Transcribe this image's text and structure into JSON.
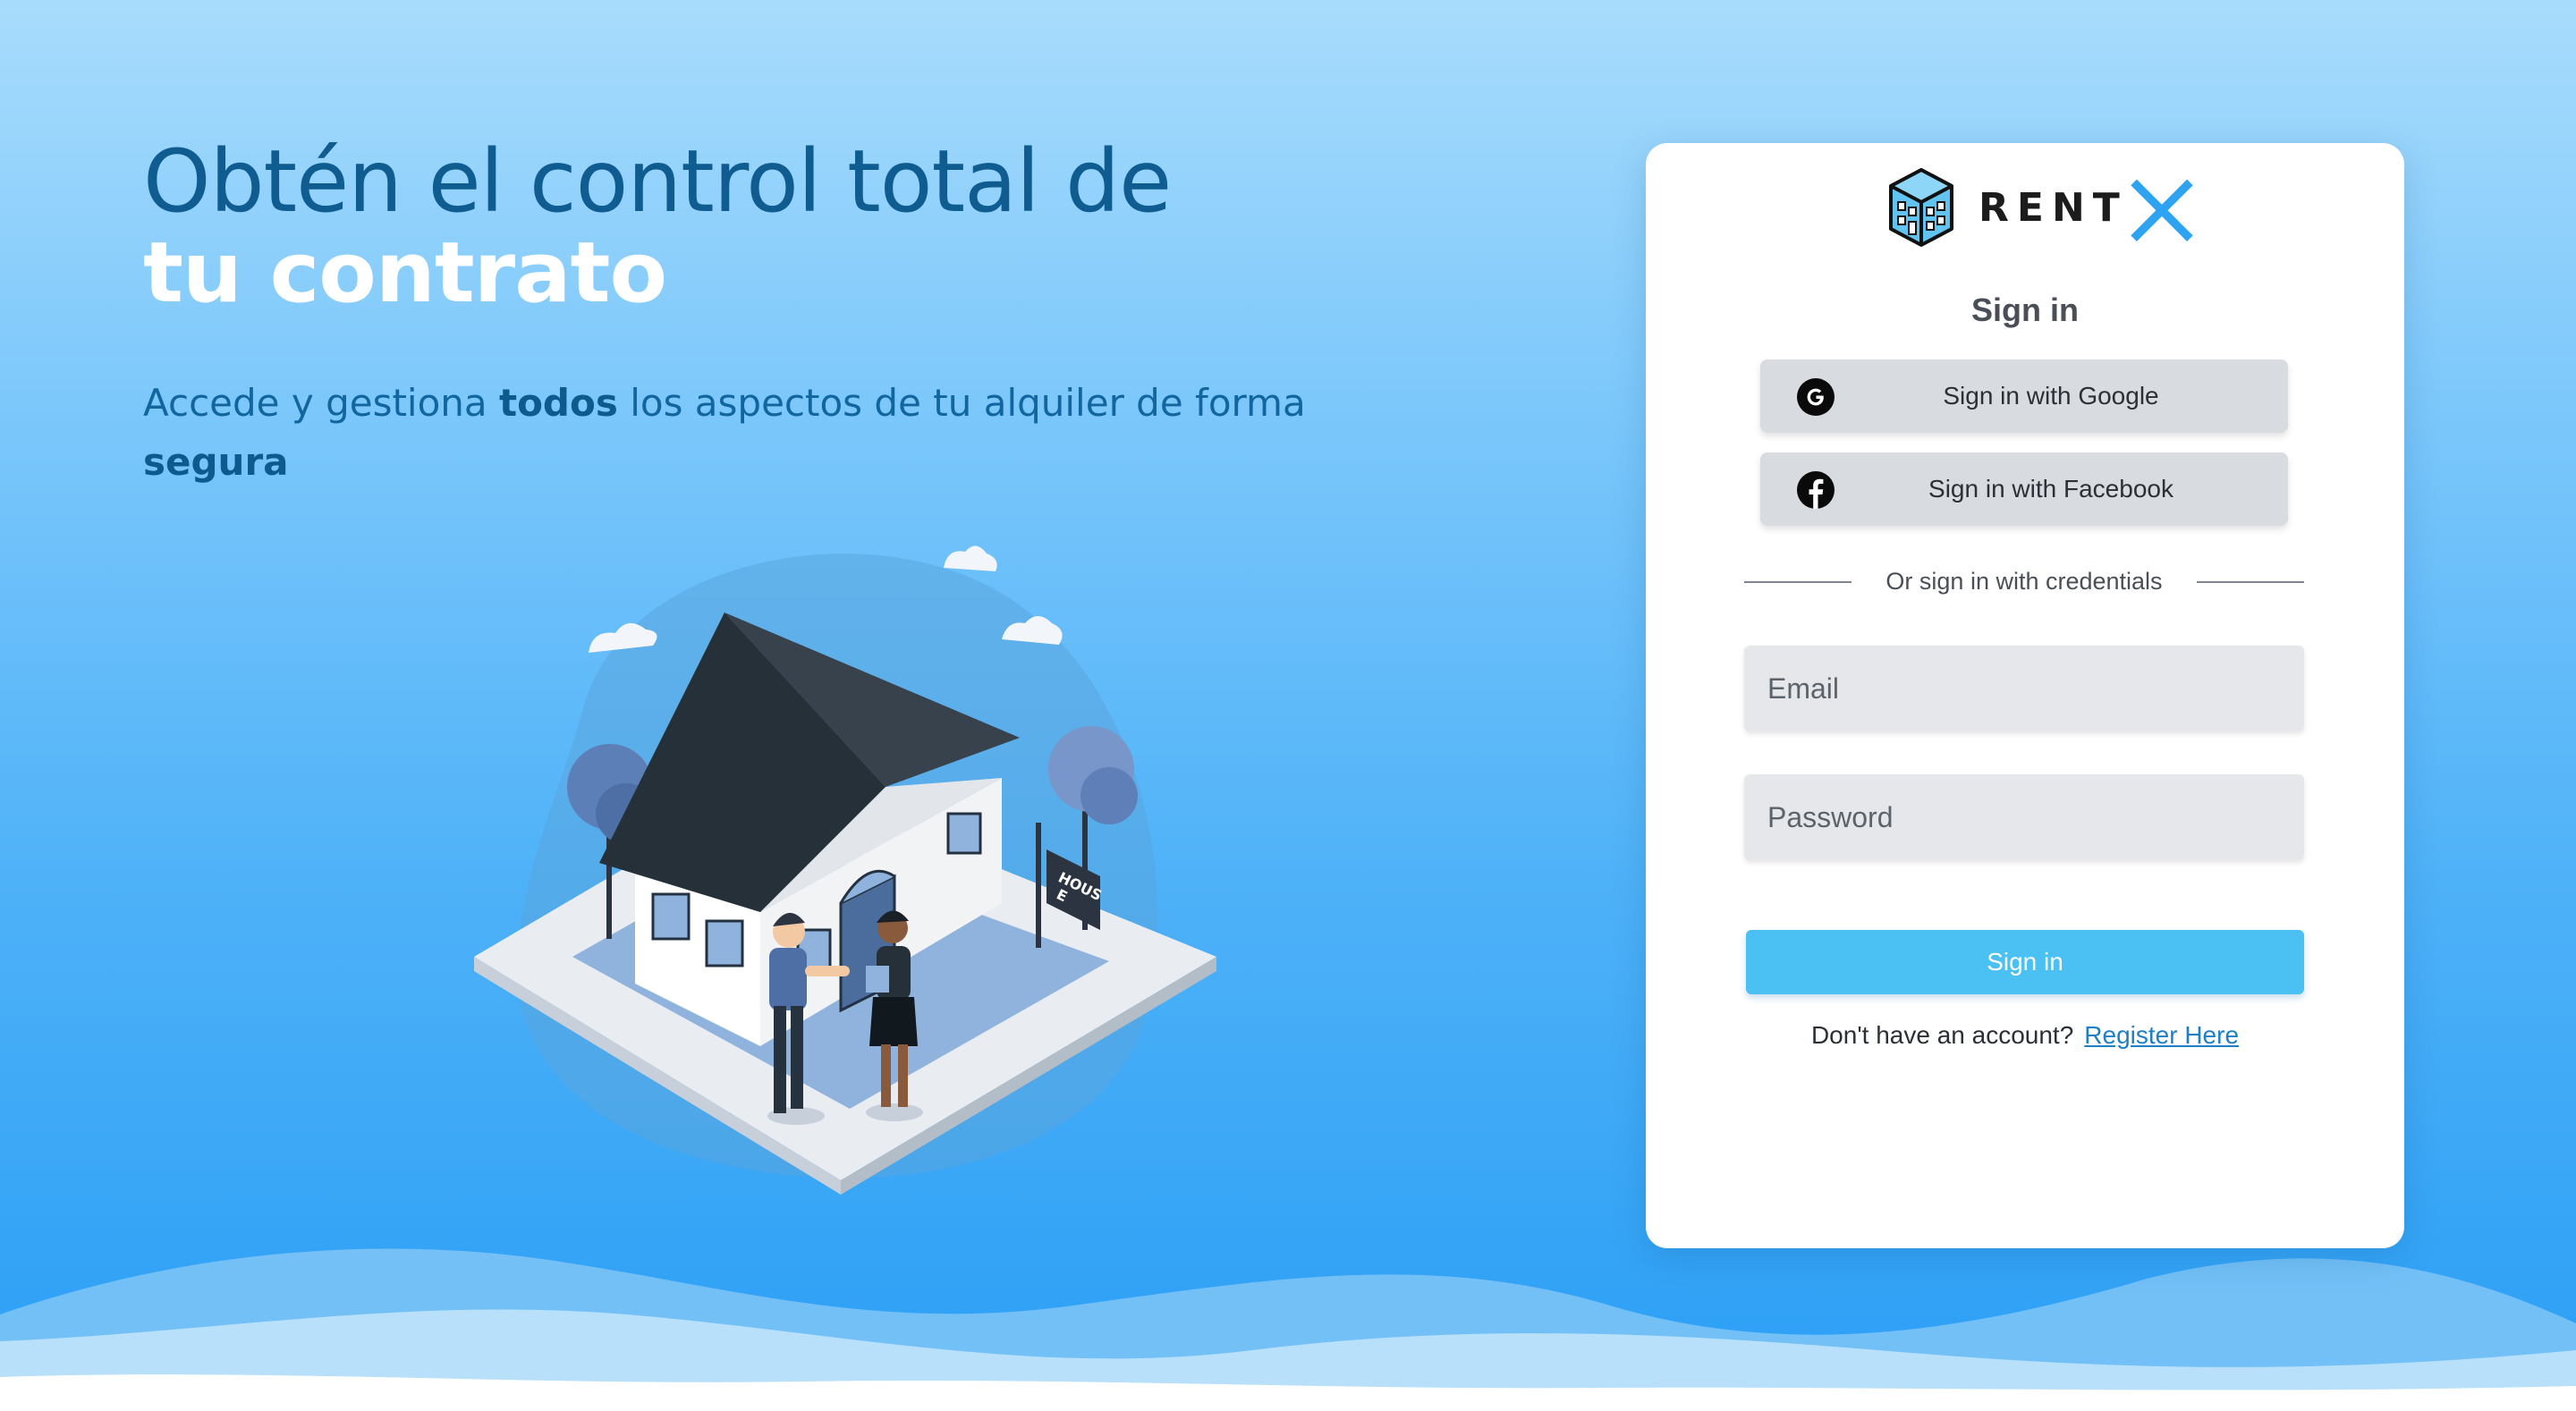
{
  "hero": {
    "headline_line1": "Obtén el control total de",
    "headline_line2": "tu contrato",
    "subtitle_part1": "Accede y gestiona ",
    "subtitle_bold1": "todos",
    "subtitle_part2": " los aspectos de tu alquiler de forma ",
    "subtitle_bold2": "segura"
  },
  "illustration": {
    "sign_text_1": "HOUS",
    "sign_text_2": "E"
  },
  "brand": {
    "name": "RENT",
    "accent": "X",
    "accent_color": "#2ea3f2",
    "icon": "building-logo-icon"
  },
  "signin": {
    "title": "Sign in",
    "google_label": "Sign in with Google",
    "google_icon": "google-icon",
    "facebook_label": "Sign in with Facebook",
    "facebook_icon": "facebook-icon",
    "divider_text": "Or sign in with credentials",
    "email_placeholder": "Email",
    "password_placeholder": "Password",
    "submit_label": "Sign in",
    "no_account_text": "Don't have an account?",
    "register_link": "Register Here"
  },
  "colors": {
    "background_top": "#a8dcfc",
    "background_bottom": "#2a9ef5",
    "headline": "#0e5c90",
    "submit": "#4bc0f2",
    "link": "#1d7fc4"
  }
}
